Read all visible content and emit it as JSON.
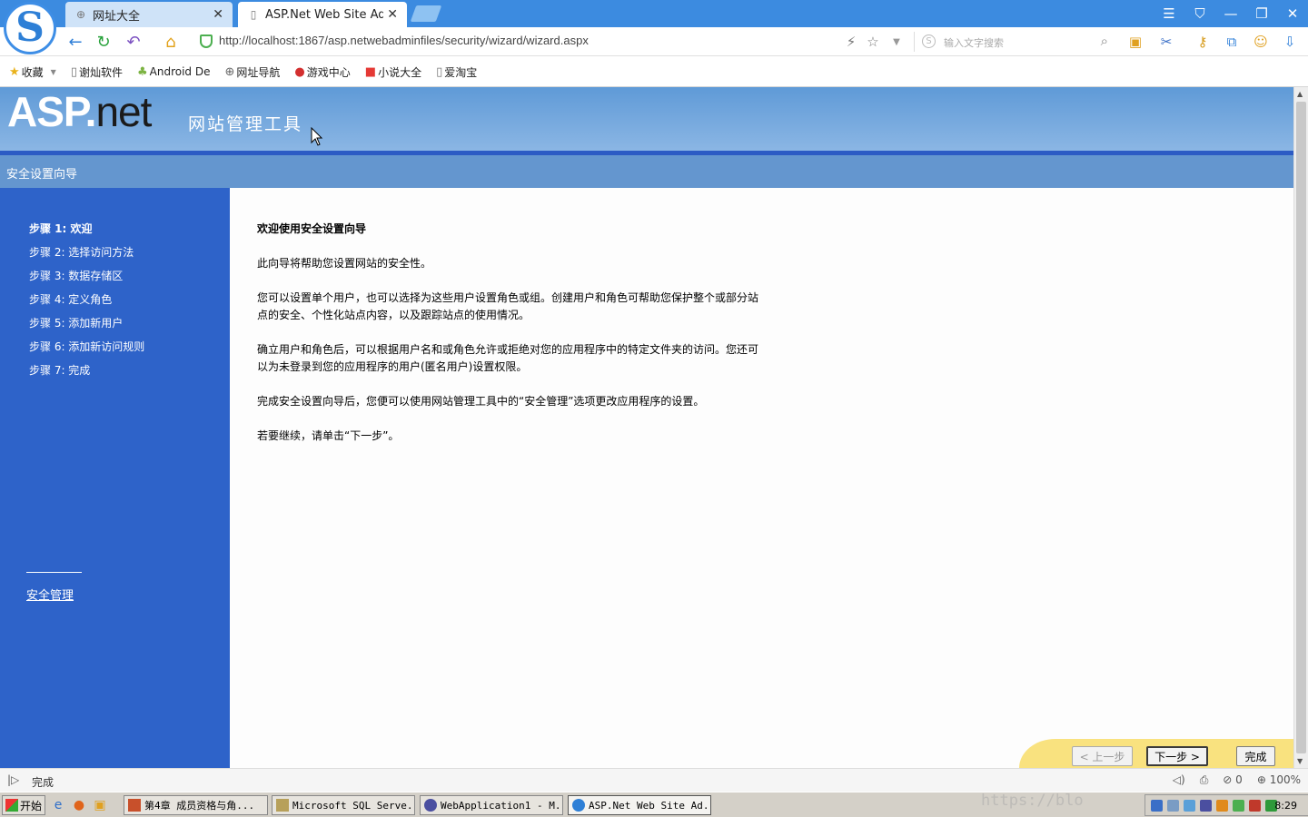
{
  "browser": {
    "tabs": [
      {
        "title": "网址大全",
        "icon": "globe-icon"
      },
      {
        "title": "ASP.Net Web Site Adm",
        "icon": "page-icon"
      }
    ],
    "url": "http://localhost:1867/asp.netwebadminfiles/security/wizard/wizard.aspx",
    "search_placeholder": "输入文字搜索",
    "favorites": [
      {
        "label": "收藏",
        "icon": "star-icon"
      },
      {
        "label": "谢灿软件",
        "icon": "page-icon"
      },
      {
        "label": "Android De",
        "icon": "android-icon"
      },
      {
        "label": "网址导航",
        "icon": "globe-icon"
      },
      {
        "label": "游戏中心",
        "icon": "game-icon"
      },
      {
        "label": "小说大全",
        "icon": "book-icon"
      },
      {
        "label": "爱淘宝",
        "icon": "page-icon"
      }
    ],
    "status_text": "完成",
    "status_right": {
      "ad_count": "0",
      "zoom": "100%"
    }
  },
  "page": {
    "logo_text": "ASP",
    "logo_net": "net",
    "banner_title": "网站管理工具",
    "section_title": "安全设置向导",
    "steps": [
      "步骤 1: 欢迎",
      "步骤 2: 选择访问方法",
      "步骤 3: 数据存储区",
      "步骤 4: 定义角色",
      "步骤 5: 添加新用户",
      "步骤 6: 添加新访问规则",
      "步骤 7: 完成"
    ],
    "side_link": "安全管理",
    "content": {
      "heading": "欢迎使用安全设置向导",
      "paragraphs": [
        "此向导将帮助您设置网站的安全性。",
        "您可以设置单个用户，也可以选择为这些用户设置角色或组。创建用户和角色可帮助您保护整个或部分站点的安全、个性化站点内容，以及跟踪站点的使用情况。",
        "确立用户和角色后，可以根据用户名和或角色允许或拒绝对您的应用程序中的特定文件夹的访问。您还可以为未登录到您的应用程序的用户(匿名用户)设置权限。",
        "完成安全设置向导后，您便可以使用网站管理工具中的“安全管理”选项更改应用程序的设置。",
        "若要继续，请单击“下一步”。"
      ]
    },
    "buttons": {
      "prev": "< 上一步",
      "next": "下一步 >",
      "finish": "完成"
    }
  },
  "taskbar": {
    "start": "开始",
    "tasks": [
      "第4章 成员资格与角...",
      "Microsoft SQL Serve...",
      "WebApplication1 - M...",
      "ASP.Net Web Site Ad..."
    ],
    "clock": "8:29",
    "watermark": "https://blo"
  }
}
